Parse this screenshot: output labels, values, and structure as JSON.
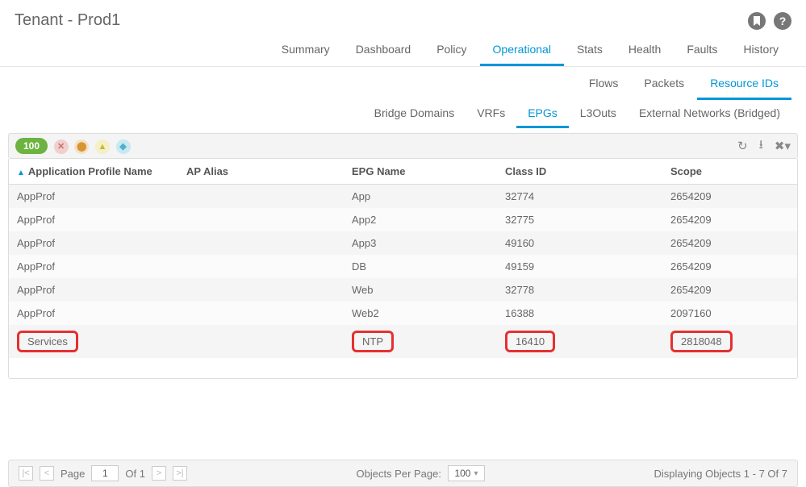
{
  "title": "Tenant - Prod1",
  "mainTabs": [
    {
      "label": "Summary",
      "active": false
    },
    {
      "label": "Dashboard",
      "active": false
    },
    {
      "label": "Policy",
      "active": false
    },
    {
      "label": "Operational",
      "active": true
    },
    {
      "label": "Stats",
      "active": false
    },
    {
      "label": "Health",
      "active": false
    },
    {
      "label": "Faults",
      "active": false
    },
    {
      "label": "History",
      "active": false
    }
  ],
  "subTabs": [
    {
      "label": "Flows",
      "active": false
    },
    {
      "label": "Packets",
      "active": false
    },
    {
      "label": "Resource IDs",
      "active": true
    }
  ],
  "subSubTabs": [
    {
      "label": "Bridge Domains",
      "active": false
    },
    {
      "label": "VRFs",
      "active": false
    },
    {
      "label": "EPGs",
      "active": true
    },
    {
      "label": "L3Outs",
      "active": false
    },
    {
      "label": "External Networks (Bridged)",
      "active": false
    }
  ],
  "healthPill": "100",
  "columns": {
    "c0": "Application Profile Name",
    "c1": "AP Alias",
    "c2": "EPG Name",
    "c3": "Class ID",
    "c4": "Scope"
  },
  "rows": [
    {
      "ap": "AppProf",
      "alias": "",
      "epg": "App",
      "cls": "32774",
      "scope": "2654209",
      "hl": false
    },
    {
      "ap": "AppProf",
      "alias": "",
      "epg": "App2",
      "cls": "32775",
      "scope": "2654209",
      "hl": false
    },
    {
      "ap": "AppProf",
      "alias": "",
      "epg": "App3",
      "cls": "49160",
      "scope": "2654209",
      "hl": false
    },
    {
      "ap": "AppProf",
      "alias": "",
      "epg": "DB",
      "cls": "49159",
      "scope": "2654209",
      "hl": false
    },
    {
      "ap": "AppProf",
      "alias": "",
      "epg": "Web",
      "cls": "32778",
      "scope": "2654209",
      "hl": false
    },
    {
      "ap": "AppProf",
      "alias": "",
      "epg": "Web2",
      "cls": "16388",
      "scope": "2097160",
      "hl": false
    },
    {
      "ap": "Services",
      "alias": "",
      "epg": "NTP",
      "cls": "16410",
      "scope": "2818048",
      "hl": true
    }
  ],
  "footer": {
    "pageLabel": "Page",
    "pageValue": "1",
    "ofLabel": "Of 1",
    "oppLabel": "Objects Per Page:",
    "oppValue": "100",
    "summary": "Displaying Objects 1 - 7 Of 7"
  }
}
